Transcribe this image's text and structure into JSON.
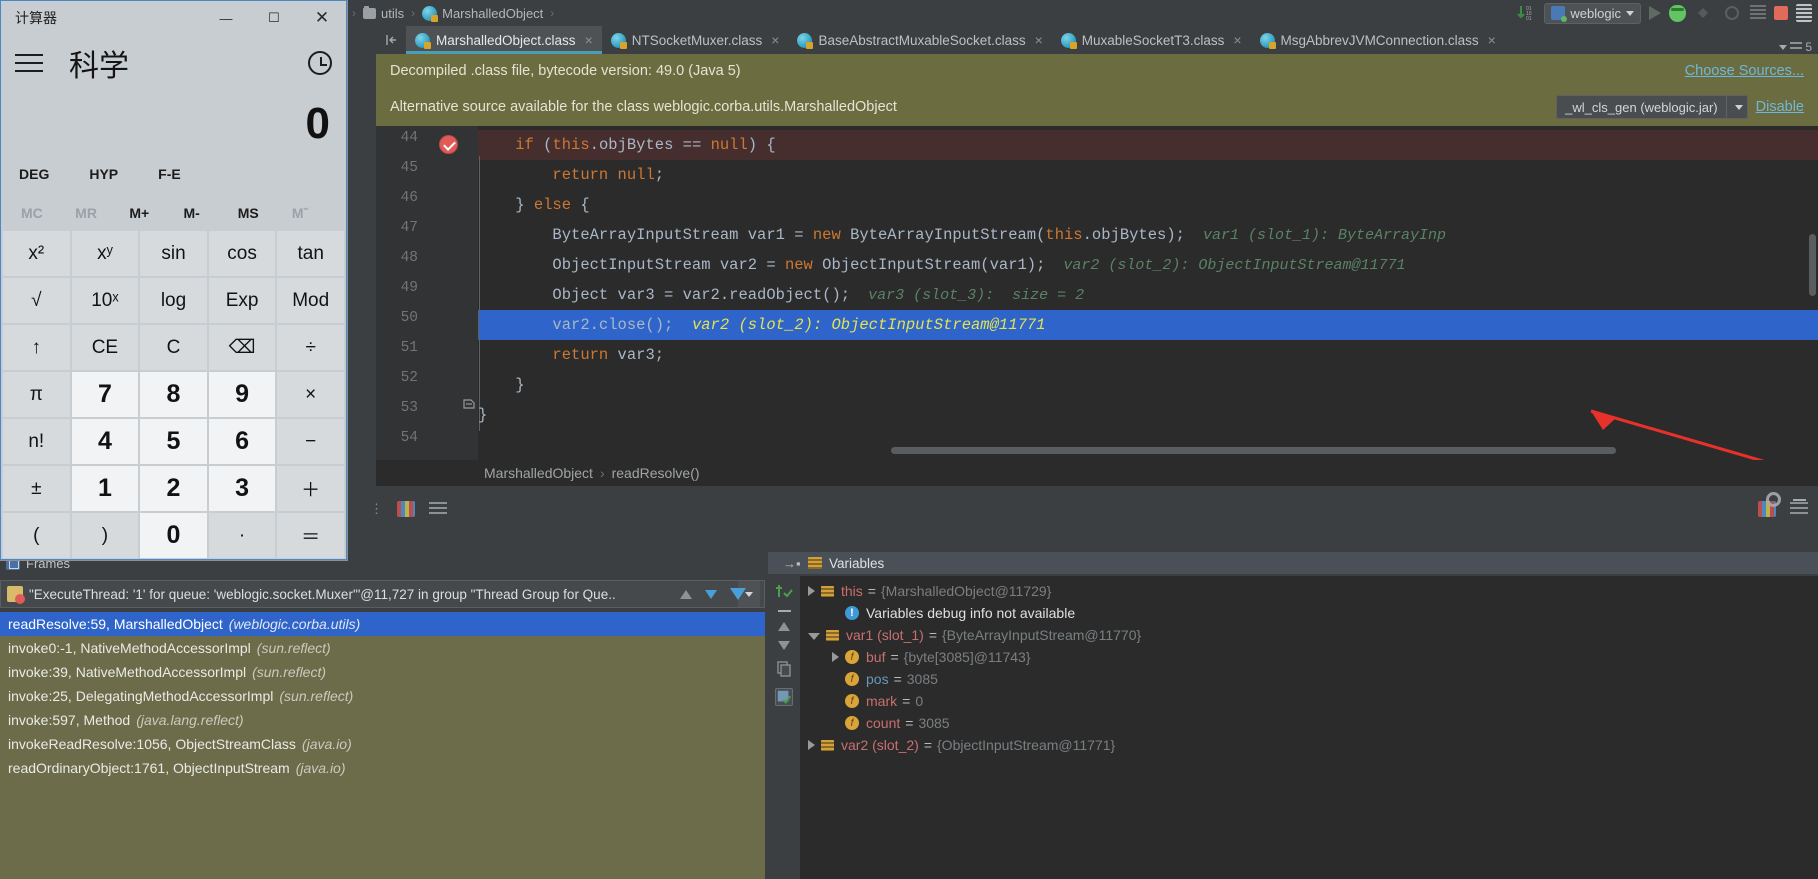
{
  "ide": {
    "breadcrumb": [
      {
        "icon": "folder-icon",
        "label": "utils"
      },
      {
        "icon": "class-icon",
        "label": "MarshalledObject"
      }
    ],
    "run_config": {
      "label": "weblogic",
      "icon": "run-config-icon"
    },
    "tabs": [
      {
        "label": "MarshalledObject.class",
        "active": true
      },
      {
        "label": "NTSocketMuxer.class",
        "active": false
      },
      {
        "label": "BaseAbstractMuxableSocket.class",
        "active": false
      },
      {
        "label": "MuxableSocketT3.class",
        "active": false
      },
      {
        "label": "MsgAbbrevJVMConnection.class",
        "active": false
      }
    ],
    "tab_overflow": "5",
    "banner1": {
      "text": "Decompiled .class file, bytecode version: 49.0 (Java 5)",
      "link": "Choose Sources..."
    },
    "banner2": {
      "text": "Alternative source available for the class weblogic.corba.utils.MarshalledObject",
      "source_select": "_wl_cls_gen (weblogic.jar)",
      "link": "Disable"
    },
    "editor": {
      "lines": [
        {
          "no": "44",
          "code": "    if (this.objBytes == null) {",
          "state": "error",
          "breakpoint": true
        },
        {
          "no": "45",
          "code": "        return null;",
          "state": "normal"
        },
        {
          "no": "46",
          "code": "    } else {",
          "state": "normal"
        },
        {
          "no": "47",
          "code": "        ByteArrayInputStream var1 = new ByteArrayInputStream(this.objBytes);",
          "hint": "var1 (slot_1): ByteArrayInp",
          "state": "normal"
        },
        {
          "no": "48",
          "code": "        ObjectInputStream var2 = new ObjectInputStream(var1);",
          "hint": "var2 (slot_2): ObjectInputStream@11771",
          "state": "normal"
        },
        {
          "no": "49",
          "code": "        Object var3 = var2.readObject();",
          "hint": "var3 (slot_3):  size = 2",
          "state": "normal"
        },
        {
          "no": "50",
          "code": "        var2.close();",
          "hint": "var2 (slot_2): ObjectInputStream@11771",
          "state": "selected"
        },
        {
          "no": "51",
          "code": "        return var3;",
          "state": "normal"
        },
        {
          "no": "52",
          "code": "    }",
          "state": "normal"
        },
        {
          "no": "53",
          "code": "}",
          "state": "normal"
        },
        {
          "no": "54",
          "code": "",
          "state": "normal"
        }
      ],
      "breadcrumb": {
        "class": "MarshalledObject",
        "method": "readResolve()"
      }
    },
    "frames": {
      "title": "Frames",
      "thread": "\"ExecuteThread: '1' for queue: 'weblogic.socket.Muxer'\"@11,727 in group \"Thread Group for Que..",
      "rows": [
        {
          "name": "readResolve:59, MarshalledObject",
          "pkg": "(weblogic.corba.utils)",
          "selected": true
        },
        {
          "name": "invoke0:-1, NativeMethodAccessorImpl",
          "pkg": "(sun.reflect)",
          "selected": false
        },
        {
          "name": "invoke:39, NativeMethodAccessorImpl",
          "pkg": "(sun.reflect)",
          "selected": false
        },
        {
          "name": "invoke:25, DelegatingMethodAccessorImpl",
          "pkg": "(sun.reflect)",
          "selected": false
        },
        {
          "name": "invoke:597, Method",
          "pkg": "(java.lang.reflect)",
          "selected": false
        },
        {
          "name": "invokeReadResolve:1056, ObjectStreamClass",
          "pkg": "(java.io)",
          "selected": false
        },
        {
          "name": "readOrdinaryObject:1761, ObjectInputStream",
          "pkg": "(java.io)",
          "selected": false
        }
      ]
    },
    "variables": {
      "title": "Variables",
      "rows": [
        {
          "indent": 0,
          "tri": "closed",
          "icon": "object-icon",
          "name": "this",
          "eq": "=",
          "value": "{MarshalledObject@11729}"
        },
        {
          "indent": 1,
          "tri": "none",
          "icon": "info-icon",
          "name": "Variables debug info not available",
          "eq": "",
          "value": ""
        },
        {
          "indent": 0,
          "tri": "open",
          "icon": "object-icon",
          "name": "var1 (slot_1)",
          "eq": "=",
          "value": "{ByteArrayInputStream@11770}"
        },
        {
          "indent": 1,
          "tri": "closed",
          "icon": "field-icon",
          "name": "buf",
          "eq": "=",
          "value": "{byte[3085]@11743}"
        },
        {
          "indent": 1,
          "tri": "none",
          "icon": "field-icon",
          "name": "pos",
          "eq": "=",
          "value": "3085",
          "nameColor": "blue"
        },
        {
          "indent": 1,
          "tri": "none",
          "icon": "field-icon",
          "name": "mark",
          "eq": "=",
          "value": "0"
        },
        {
          "indent": 1,
          "tri": "none",
          "icon": "field-icon",
          "name": "count",
          "eq": "=",
          "value": "3085"
        },
        {
          "indent": 0,
          "tri": "closed",
          "icon": "object-icon",
          "name": "var2 (slot_2)",
          "eq": "=",
          "value": "{ObjectInputStream@11771}"
        }
      ]
    }
  },
  "calculator": {
    "title": "计算器",
    "window_controls": {
      "minimize": "—",
      "maximize": "☐",
      "close": "✕"
    },
    "mode": "科学",
    "display": "0",
    "modes": [
      "DEG",
      "HYP",
      "F-E"
    ],
    "memory": [
      {
        "label": "MC",
        "dim": true
      },
      {
        "label": "MR",
        "dim": true
      },
      {
        "label": "M+",
        "dim": false
      },
      {
        "label": "M-",
        "dim": false
      },
      {
        "label": "MS",
        "dim": false
      },
      {
        "label": "Mˇ",
        "dim": true
      }
    ],
    "keys": [
      {
        "label": "x²",
        "type": "fn"
      },
      {
        "label": "xʸ",
        "type": "fn"
      },
      {
        "label": "sin",
        "type": "fn"
      },
      {
        "label": "cos",
        "type": "fn"
      },
      {
        "label": "tan",
        "type": "fn"
      },
      {
        "label": "√",
        "type": "fn"
      },
      {
        "label": "10ˣ",
        "type": "fn"
      },
      {
        "label": "log",
        "type": "fn"
      },
      {
        "label": "Exp",
        "type": "fn"
      },
      {
        "label": "Mod",
        "type": "fn"
      },
      {
        "label": "↑",
        "type": "fn"
      },
      {
        "label": "CE",
        "type": "fn"
      },
      {
        "label": "C",
        "type": "fn"
      },
      {
        "label": "⌫",
        "type": "fn"
      },
      {
        "label": "÷",
        "type": "fn"
      },
      {
        "label": "π",
        "type": "fn"
      },
      {
        "label": "7",
        "type": "num"
      },
      {
        "label": "8",
        "type": "num"
      },
      {
        "label": "9",
        "type": "num"
      },
      {
        "label": "×",
        "type": "fn"
      },
      {
        "label": "n!",
        "type": "fn"
      },
      {
        "label": "4",
        "type": "num"
      },
      {
        "label": "5",
        "type": "num"
      },
      {
        "label": "6",
        "type": "num"
      },
      {
        "label": "−",
        "type": "fn"
      },
      {
        "label": "±",
        "type": "fn"
      },
      {
        "label": "1",
        "type": "num"
      },
      {
        "label": "2",
        "type": "num"
      },
      {
        "label": "3",
        "type": "num"
      },
      {
        "label": "＋",
        "type": "fn"
      },
      {
        "label": "(",
        "type": "fn"
      },
      {
        "label": ")",
        "type": "fn"
      },
      {
        "label": "0",
        "type": "num"
      },
      {
        "label": "·",
        "type": "fn"
      },
      {
        "label": "＝",
        "type": "fn"
      }
    ]
  }
}
